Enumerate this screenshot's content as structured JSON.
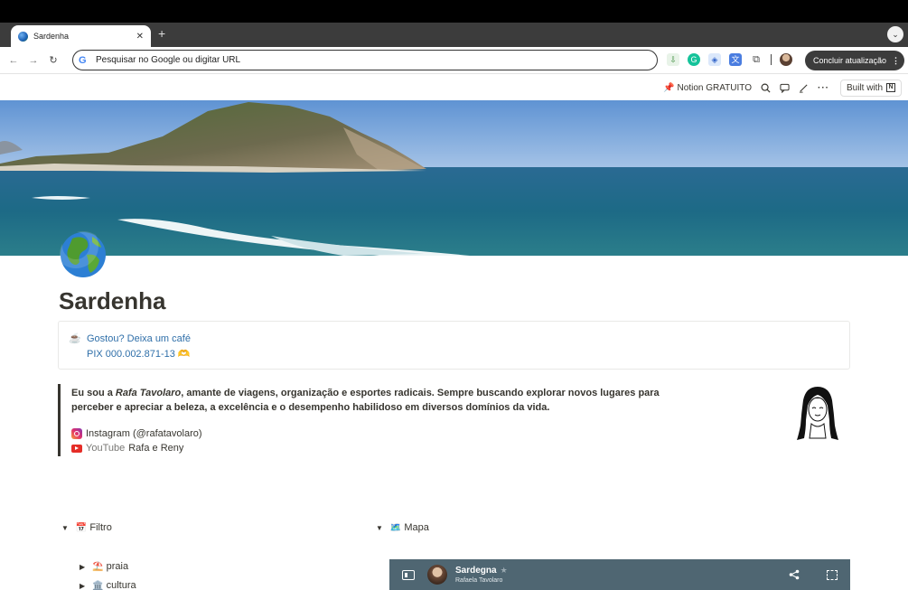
{
  "browser": {
    "tab_title": "Sardenha",
    "tab_close": "✕",
    "new_tab": "+",
    "tab_menu": "⌄",
    "omnibox_placeholder": "Pesquisar no Google ou digitar URL",
    "update_button": "Concluir atualização",
    "nav": {
      "back": "←",
      "forward": "→",
      "reload": "↻"
    }
  },
  "notion_topbar": {
    "pin_emoji": "📌",
    "plan_label": "Notion GRATUITO",
    "built_with": "Built with"
  },
  "page": {
    "icon_emoji": "🌍",
    "title": "Sardenha",
    "callout": {
      "icon": "☕",
      "line1": "Gostou? Deixa um café",
      "line2": "PIX 000.002.871-13 🫶"
    },
    "quote": {
      "prefix": "Eu sou a ",
      "name": "Rafa Tavolaro",
      "rest": ", amante de viagens, organização e esportes radicais. Sempre buscando explorar novos lugares para perceber e apreciar a beleza, a excelência e o desempenho habilidoso em diversos domínios da vida.",
      "instagram_label": "Instagram (@rafatavolaro)",
      "youtube_prefix": "YouTube",
      "youtube_label": "Rafa e Reny"
    },
    "toggles": {
      "filtro": {
        "emoji": "📅",
        "label": "Filtro"
      },
      "mapa": {
        "emoji": "🗺️",
        "label": "Mapa"
      },
      "praia": {
        "emoji": "⛱️",
        "label": "praia"
      },
      "cultura": {
        "emoji": "🏛️",
        "label": "cultura"
      }
    },
    "map_embed": {
      "title": "Sardegna",
      "star": "★",
      "author": "Rafaela Tavolaro",
      "share_icon": "share-icon"
    }
  },
  "colors": {
    "link_blue": "#2f6fa9",
    "text": "#37352f",
    "map_header": "#4f6672",
    "update_button_bg": "#3c3c3c"
  }
}
